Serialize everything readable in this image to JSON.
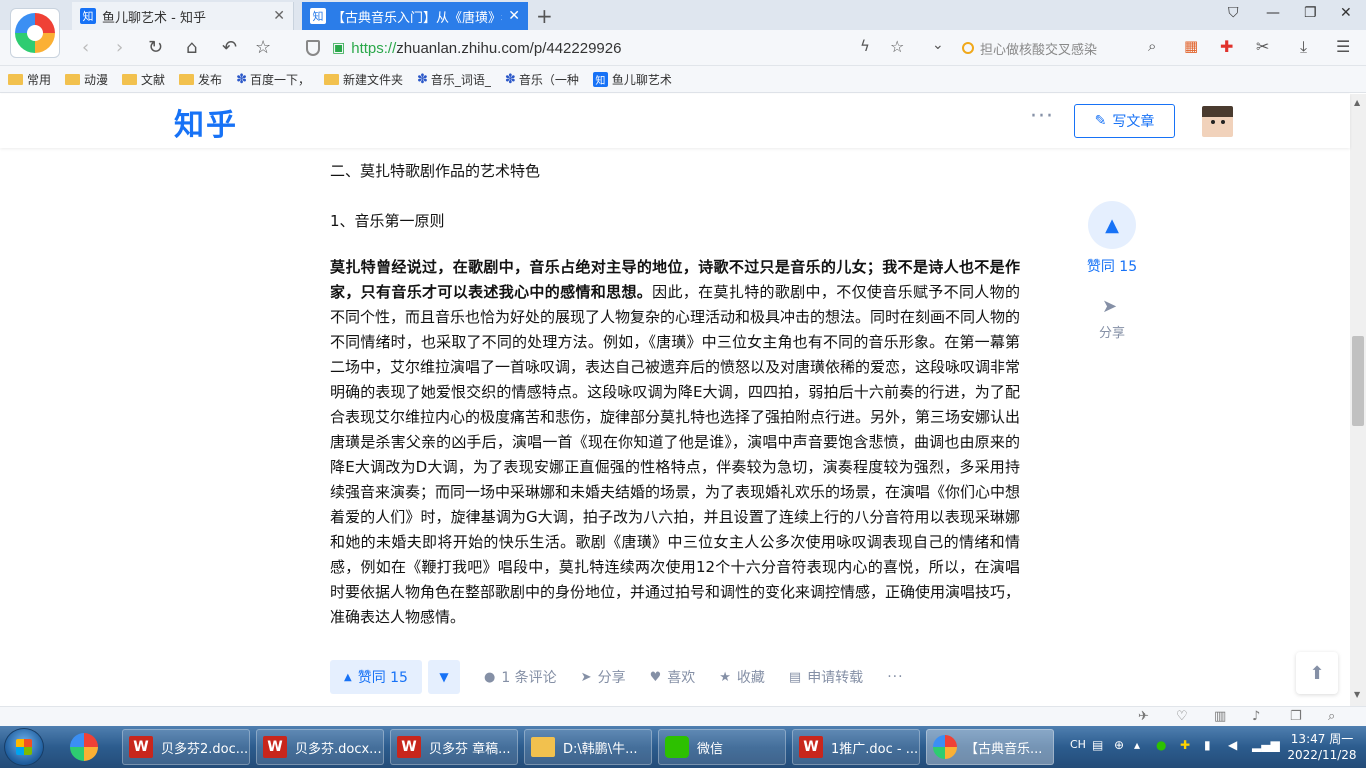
{
  "browser": {
    "tabs": [
      {
        "icon_text": "知",
        "title": "鱼儿聊艺术 - 知乎"
      },
      {
        "icon_text": "知",
        "title": "【古典音乐入门】从《唐璜》看"
      }
    ],
    "url_scheme": "https://",
    "url_rest": "zhuanlan.zhihu.com/p/442229926",
    "search_placeholder": "担心做核酸交叉感染",
    "bookmarks": [
      {
        "type": "folder",
        "label": "常用"
      },
      {
        "type": "folder",
        "label": "动漫"
      },
      {
        "type": "folder",
        "label": "文献"
      },
      {
        "type": "folder",
        "label": "发布"
      },
      {
        "type": "paw",
        "label": "百度一下，"
      },
      {
        "type": "folder",
        "label": "新建文件夹"
      },
      {
        "type": "paw",
        "label": "音乐_词语_"
      },
      {
        "type": "paw",
        "label": "音乐（一种"
      },
      {
        "type": "zhihu",
        "label": "鱼儿聊艺术"
      }
    ]
  },
  "zhihu": {
    "logo": "知乎",
    "more": "···",
    "write_label": "写文章"
  },
  "article": {
    "section_title": "二、莫扎特歌剧作品的艺术特色",
    "sub_title": "1、音乐第一原则",
    "bold_lead": "莫扎特曾经说过，在歌剧中，音乐占绝对主导的地位，诗歌不过只是音乐的儿女；我不是诗人也不是作家，只有音乐才可以表述我心中的感情和思想。",
    "body": "因此，在莫扎特的歌剧中，不仅使音乐赋予不同人物的不同个性，而且音乐也恰为好处的展现了人物复杂的心理活动和极具冲击的想法。同时在刻画不同人物的不同情绪时，也采取了不同的处理方法。例如，《唐璜》中三位女主角也有不同的音乐形象。在第一幕第二场中，艾尔维拉演唱了一首咏叹调，表达自己被遗弃后的愤怒以及对唐璜依稀的爱恋，这段咏叹调非常明确的表现了她爱恨交织的情感特点。这段咏叹调为降E大调，四四拍，弱拍后十六前奏的行进，为了配合表现艾尔维拉内心的极度痛苦和悲伤，旋律部分莫扎特也选择了强拍附点行进。另外，第三场安娜认出唐璜是杀害父亲的凶手后，演唱一首《现在你知道了他是谁》，演唱中声音要饱含悲愤，曲调也由原来的降E大调改为D大调，为了表现安娜正直倔强的性格特点，伴奏较为急切，演奏程度较为强烈，多采用持续强音来演奏；而同一场中采琳娜和未婚夫结婚的场景，为了表现婚礼欢乐的场景，在演唱《你们心中想着爱的人们》时，旋律基调为G大调，拍子改为八六拍，并且设置了连续上行的八分音符用以表现采琳娜和她的未婚夫即将开始的快乐生活。歌剧《唐璜》中三位女主人公多次使用咏叹调表现自己的情绪和情感，例如在《鞭打我吧》唱段中，莫扎特连续两次使用12个十六分音符表现内心的喜悦，所以，在演唱时要依据人物角色在整部歌剧中的身份地位，并通过拍号和调性的变化来调控情感，正确使用演唱技巧，准确表达人物感情。"
  },
  "actions": {
    "vote_up": "赞同 15",
    "comments": "1 条评论",
    "share": "分享",
    "like": "喜欢",
    "collect": "收藏",
    "reprint": "申请转载",
    "more": "···"
  },
  "side": {
    "vote_label": "赞同 15",
    "share_label": "分享"
  },
  "taskbar": {
    "tasks": [
      {
        "kind": "wps",
        "label": "贝多芬2.doc..."
      },
      {
        "kind": "wps",
        "label": "贝多芬.docx..."
      },
      {
        "kind": "wps",
        "label": "贝多芬 章稿..."
      },
      {
        "kind": "folder",
        "label": "D:\\韩鹏\\牛..."
      },
      {
        "kind": "wechat",
        "label": "微信"
      },
      {
        "kind": "wps",
        "label": "1推广.doc - ..."
      },
      {
        "kind": "browser",
        "label": "【古典音乐..."
      }
    ],
    "lang": "CH",
    "time": "13:47 周一",
    "date": "2022/11/28"
  }
}
